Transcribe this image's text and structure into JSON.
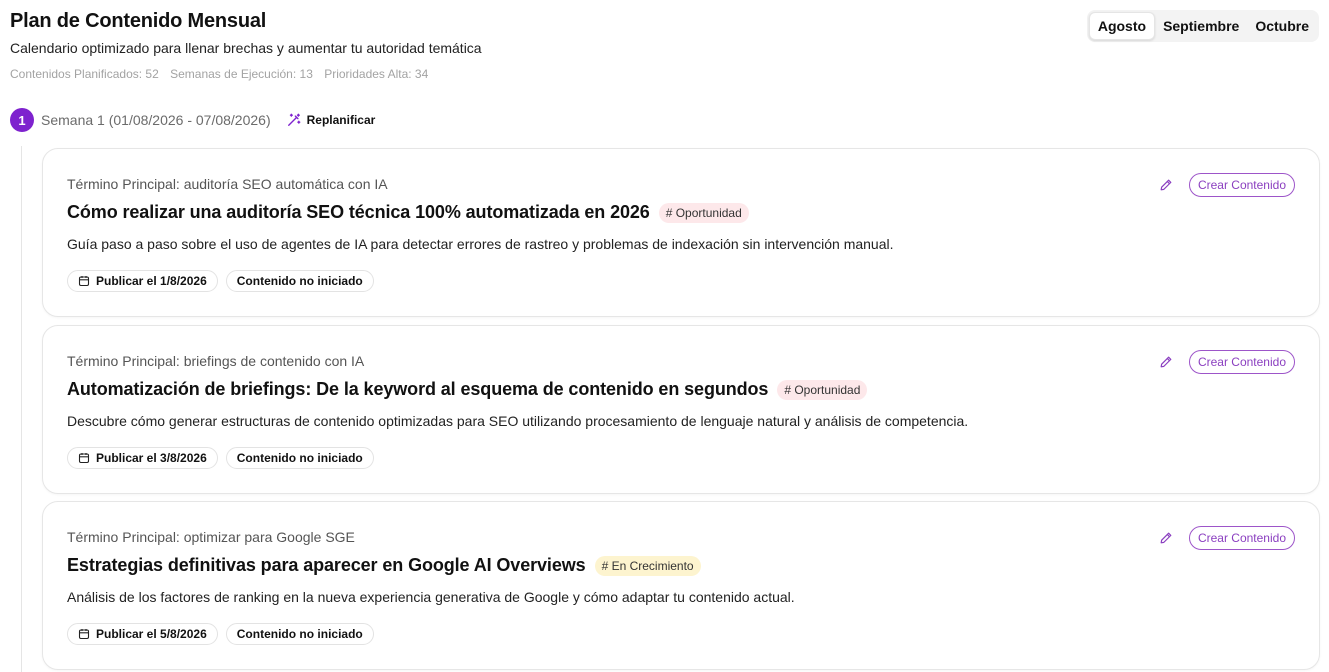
{
  "header": {
    "title": "Plan de Contenido Mensual",
    "subtitle": "Calendario optimizado para llenar brechas y aumentar tu autoridad temática",
    "stats": [
      "Contenidos Planificados: 52",
      "Semanas de Ejecución: 13",
      "Prioridades Alta: 34"
    ]
  },
  "months": [
    {
      "label": "Agosto",
      "active": true
    },
    {
      "label": "Septiembre",
      "active": false
    },
    {
      "label": "Octubre",
      "active": false
    }
  ],
  "week": {
    "number": "1",
    "label": "Semana 1 (01/08/2026 - 07/08/2026)",
    "replan_label": "Replanificar"
  },
  "cards": [
    {
      "term": "Término Principal: auditoría SEO automática con IA",
      "title": "Cómo realizar una auditoría SEO técnica 100% automatizada en 2026",
      "tag": "# Oportunidad",
      "description": "Guía paso a paso sobre el uso de agentes de IA para detectar errores de rastreo y problemas de indexación sin intervención manual.",
      "publish": "Publicar el 1/8/2026",
      "status": "Contenido no iniciado",
      "create_label": "Crear Contenido"
    },
    {
      "term": "Término Principal: briefings de contenido con IA",
      "title": "Automatización de briefings: De la keyword al esquema de contenido en segundos",
      "tag": "# Oportunidad",
      "description": "Descubre cómo generar estructuras de contenido optimizadas para SEO utilizando procesamiento de lenguaje natural y análisis de competencia.",
      "publish": "Publicar el 3/8/2026",
      "status": "Contenido no iniciado",
      "create_label": "Crear Contenido"
    },
    {
      "term": "Término Principal: optimizar para Google SGE",
      "title": "Estrategias definitivas para aparecer en Google AI Overviews",
      "tag": "# En Crecimiento",
      "description": "Análisis de los factores de ranking en la nueva experiencia generativa de Google y cómo adaptar tu contenido actual.",
      "publish": "Publicar el 5/8/2026",
      "status": "Contenido no iniciado",
      "create_label": "Crear Contenido"
    }
  ],
  "colors": {
    "accent": "#7e22ce",
    "tag_opportunity": "#fde8ea",
    "tag_growth": "#fdf4cf"
  }
}
